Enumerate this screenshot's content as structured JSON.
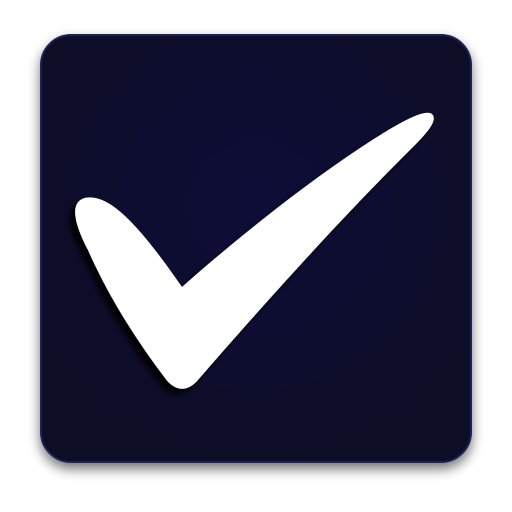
{
  "icon": {
    "name": "checkmark-icon",
    "background_color": "#090c33",
    "border_color": "#1a2358",
    "shadow_color": "#000000",
    "check_color": "#ffffff"
  }
}
